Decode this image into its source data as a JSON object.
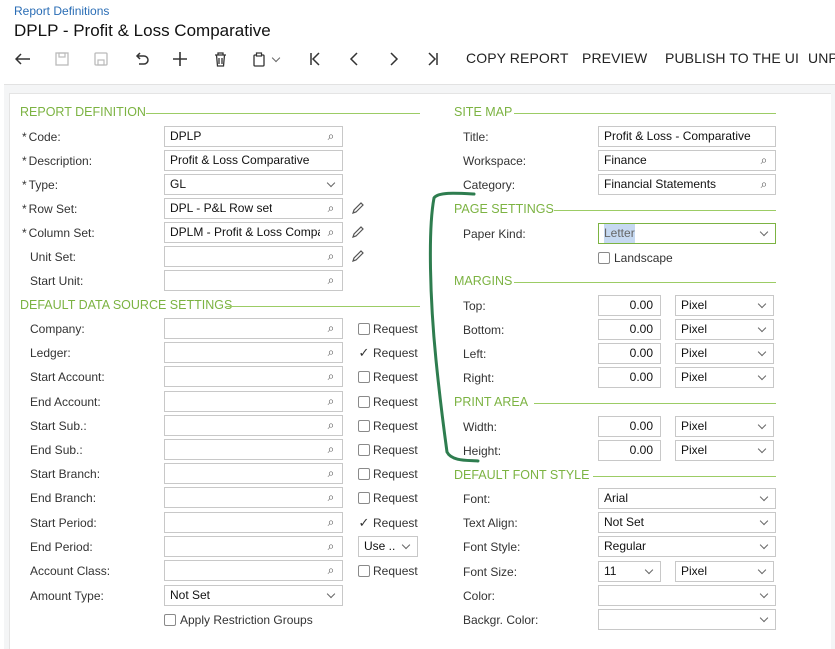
{
  "breadcrumb": "Report Definitions",
  "title": "DPLP - Profit & Loss Comparative",
  "toolbar": {
    "copy_report": "COPY REPORT",
    "preview": "PREVIEW",
    "publish": "PUBLISH TO THE UI",
    "unpublish": "UNP"
  },
  "sections": {
    "report_definition": "REPORT DEFINITION",
    "default_data_source": "DEFAULT DATA SOURCE SETTINGS",
    "site_map": "SITE MAP",
    "page_settings": "PAGE SETTINGS",
    "margins": "MARGINS",
    "print_area": "PRINT AREA",
    "default_font_style": "DEFAULT FONT STYLE"
  },
  "report": {
    "code_label": "Code:",
    "code": "DPLP",
    "description_label": "Description:",
    "description": "Profit & Loss Comparative",
    "type_label": "Type:",
    "type": "GL",
    "row_set_label": "Row Set:",
    "row_set": "DPL - P&L Row set",
    "column_set_label": "Column Set:",
    "column_set": "DPLM - Profit & Loss Compar",
    "unit_set_label": "Unit Set:",
    "unit_set": "",
    "start_unit_label": "Start Unit:",
    "start_unit": ""
  },
  "data_source": {
    "request_label": "Request",
    "rows": [
      {
        "label": "Company:",
        "value": "",
        "request": false
      },
      {
        "label": "Ledger:",
        "value": "",
        "request": true
      },
      {
        "label": "Start Account:",
        "value": "",
        "request": false
      },
      {
        "label": "End Account:",
        "value": "",
        "request": false
      },
      {
        "label": "Start Sub.:",
        "value": "",
        "request": false
      },
      {
        "label": "End Sub.:",
        "value": "",
        "request": false
      },
      {
        "label": "Start Branch:",
        "value": "",
        "request": false
      },
      {
        "label": "End Branch:",
        "value": "",
        "request": false
      },
      {
        "label": "Start Period:",
        "value": "",
        "request": true
      },
      {
        "label": "End Period:",
        "value": "",
        "use": "Use ..."
      },
      {
        "label": "Account Class:",
        "value": "",
        "request": false
      }
    ],
    "amount_type_label": "Amount Type:",
    "amount_type": "Not Set",
    "apply_restriction": "Apply Restriction Groups"
  },
  "site_map": {
    "title_label": "Title:",
    "title": "Profit & Loss - Comparative",
    "workspace_label": "Workspace:",
    "workspace": "Finance",
    "category_label": "Category:",
    "category": "Financial Statements"
  },
  "page_settings": {
    "paper_kind_label": "Paper Kind:",
    "paper_kind": "Letter",
    "landscape_label": "Landscape"
  },
  "margins": {
    "top_label": "Top:",
    "top": "0.00",
    "top_unit": "Pixel",
    "bottom_label": "Bottom:",
    "bottom": "0.00",
    "bottom_unit": "Pixel",
    "left_label": "Left:",
    "left": "0.00",
    "left_unit": "Pixel",
    "right_label": "Right:",
    "right": "0.00",
    "right_unit": "Pixel"
  },
  "print_area": {
    "width_label": "Width:",
    "width": "0.00",
    "width_unit": "Pixel",
    "height_label": "Height:",
    "height": "0.00",
    "height_unit": "Pixel"
  },
  "font_style": {
    "font_label": "Font:",
    "font": "Arial",
    "align_label": "Text Align:",
    "align": "Not Set",
    "style_label": "Font Style:",
    "style": "Regular",
    "size_label": "Font Size:",
    "size": "11",
    "size_unit": "Pixel",
    "color_label": "Color:",
    "color": "",
    "bg_label": "Backgr. Color:",
    "bg": ""
  },
  "colors": {
    "section": "#7cb342",
    "link": "#2a6db5",
    "annotation": "#2e7d4f"
  }
}
